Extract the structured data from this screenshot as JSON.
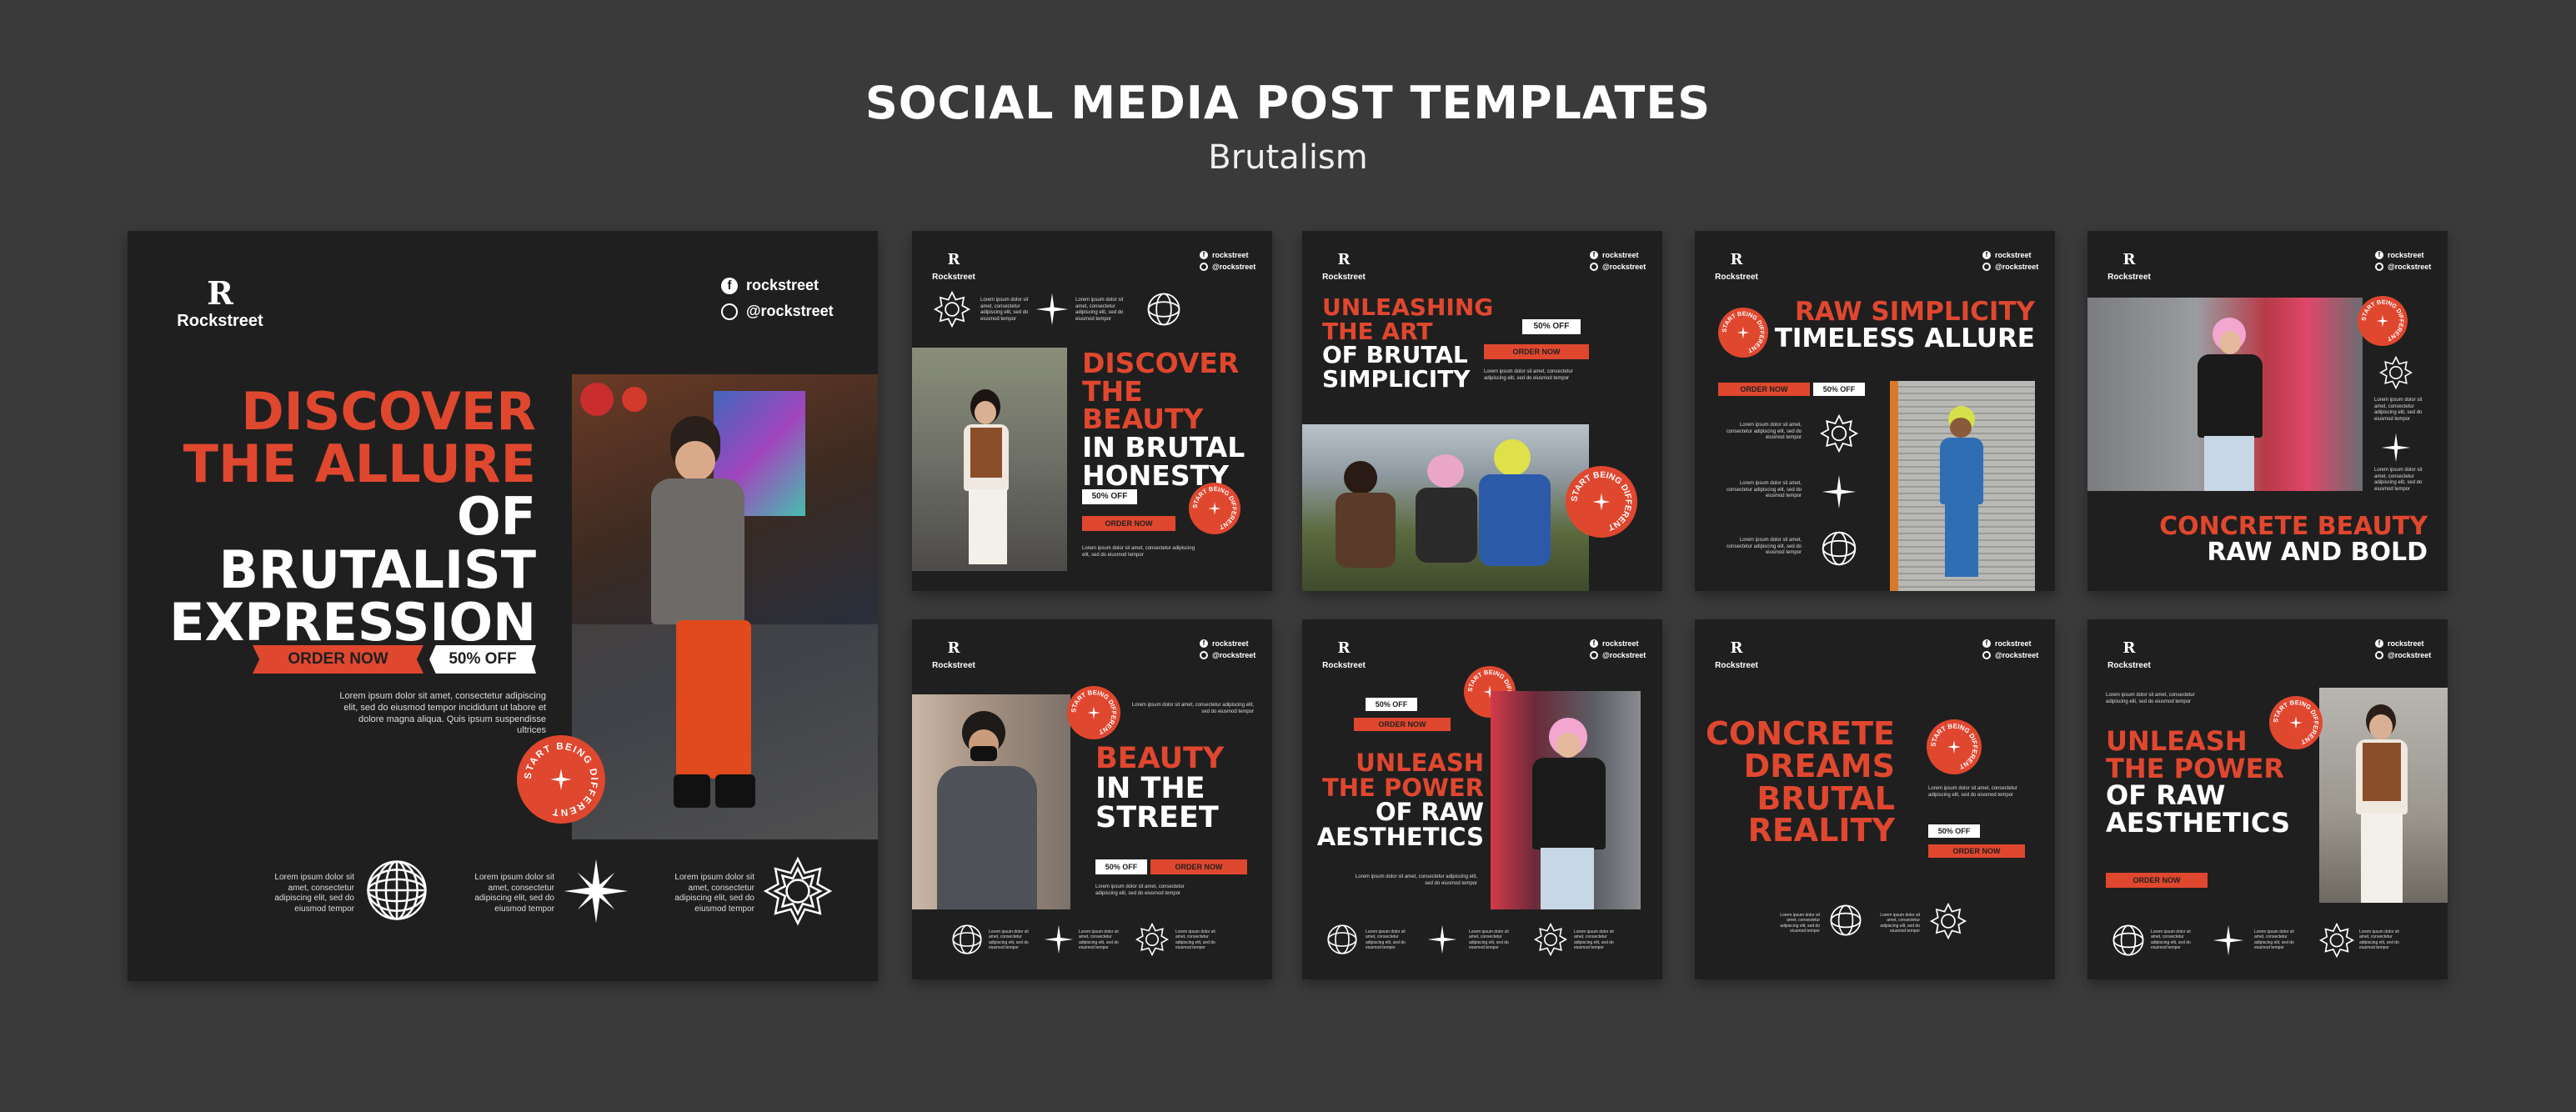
{
  "header": {
    "title": "SOCIAL MEDIA POST TEMPLATES",
    "subtitle": "Brutalism"
  },
  "brand": {
    "logo_letter": "R",
    "name": "Rockstreet",
    "facebook": "rockstreet",
    "instagram": "@rockstreet"
  },
  "colors": {
    "background": "#3a3a3a",
    "card": "#1f1f1f",
    "accent": "#e0472f",
    "text": "#ffffff"
  },
  "badge_text": "START BEING DIFFERENT",
  "icons": [
    "facebook-icon",
    "instagram-icon",
    "wavy-sphere-shape",
    "four-point-star-shape",
    "wavy-burst-shape"
  ],
  "lorem": {
    "long": "Lorem ipsum dolor sit amet, consectetur adipiscing elit, sed do eiusmod tempor incididunt ut labore et dolore magna aliqua. Quis ipsum suspendisse ultrices",
    "short": "Lorem ipsum dolor sit amet, consectetur adipiscing elit, sed do eiusmod tempor"
  },
  "main": {
    "headline": [
      "DISCOVER",
      "THE ALLURE",
      "OF BRUTALIST",
      "EXPRESSION"
    ],
    "order_label": "ORDER NOW",
    "discount_label": "50% OFF"
  },
  "cards": [
    {
      "headline": [
        "DISCOVER",
        "THE BEAUTY",
        "IN BRUTAL",
        "HONESTY"
      ],
      "discount": "50% OFF",
      "order": "ORDER NOW"
    },
    {
      "headline": [
        "UNLEASHING",
        "THE ART",
        "OF BRUTAL",
        "SIMPLICITY"
      ],
      "discount": "50% OFF",
      "order": "ORDER NOW"
    },
    {
      "headline": [
        "RAW SIMPLICITY",
        "TIMELESS ALLURE"
      ],
      "discount": "50% OFF",
      "order": "ORDER NOW"
    },
    {
      "headline": [
        "CONCRETE BEAUTY",
        "RAW AND BOLD"
      ]
    },
    {
      "headline": [
        "BEAUTY",
        "IN THE",
        "STREET"
      ],
      "discount": "50% OFF",
      "order": "ORDER NOW"
    },
    {
      "headline": [
        "UNLEASH",
        "THE POWER",
        "OF RAW",
        "AESTHETICS"
      ],
      "discount": "50% OFF",
      "order": "ORDER NOW"
    },
    {
      "headline": [
        "CONCRETE",
        "DREAMS",
        "BRUTAL",
        "REALITY"
      ],
      "discount": "50% OFF",
      "order": "ORDER NOW"
    },
    {
      "headline": [
        "UNLEASH",
        "THE POWER",
        "OF RAW",
        "AESTHETICS"
      ],
      "order": "ORDER NOW"
    }
  ]
}
